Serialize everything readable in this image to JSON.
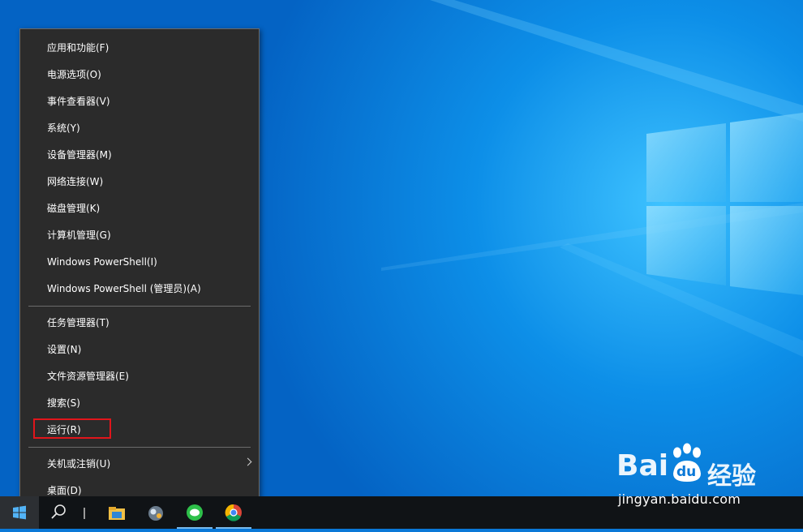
{
  "menu": {
    "items": [
      {
        "label": "应用和功能(F)"
      },
      {
        "label": "电源选项(O)"
      },
      {
        "label": "事件查看器(V)"
      },
      {
        "label": "系统(Y)"
      },
      {
        "label": "设备管理器(M)"
      },
      {
        "label": "网络连接(W)"
      },
      {
        "label": "磁盘管理(K)"
      },
      {
        "label": "计算机管理(G)"
      },
      {
        "label": "Windows PowerShell(I)"
      },
      {
        "label": "Windows PowerShell (管理员)(A)"
      },
      {
        "label": "任务管理器(T)"
      },
      {
        "label": "设置(N)"
      },
      {
        "label": "文件资源管理器(E)"
      },
      {
        "label": "搜索(S)"
      },
      {
        "label": "运行(R)",
        "highlighted": true
      },
      {
        "label": "关机或注销(U)",
        "has_submenu": true
      },
      {
        "label": "桌面(D)"
      }
    ],
    "highlight_color": "#e0151b"
  },
  "taskbar": {
    "icons": [
      "windows-start-icon",
      "search-icon",
      "task-view-icon",
      "file-explorer-icon",
      "app-icon",
      "wechat-icon",
      "chrome-icon"
    ]
  },
  "watermark": {
    "brand_bai": "Bai",
    "brand_du": "du",
    "brand_cn": "经验",
    "url": "jingyan.baidu.com"
  },
  "colors": {
    "desktop": "#0a78d7",
    "menu_bg": "#2b2b2b",
    "taskbar": "#101316"
  }
}
